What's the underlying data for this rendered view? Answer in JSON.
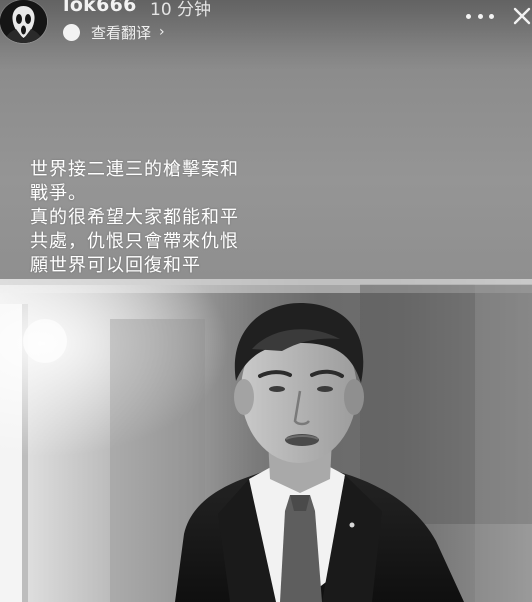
{
  "header": {
    "username": "lok666",
    "timestamp": "10 分钟",
    "translate_label": "查看翻译",
    "translate_chevron": "›"
  },
  "icons": {
    "avatar": "ghostface-mask-avatar",
    "translate": "translate-dot-icon",
    "more": "more-dots-icon",
    "close": "close-icon",
    "chevron": "chevron-right-icon"
  },
  "caption": {
    "lines": [
      "世界接二連三的槍擊案和",
      "戰爭。",
      "真的很希望大家都能和平",
      "共處，仇恨只會帶來仇恨",
      "願世界可以回復和平"
    ]
  },
  "photo": {
    "style": "black-and-white",
    "subject": "man-in-dark-suit-speaking"
  },
  "colors": {
    "overlay_background": "#8d8d8d",
    "text": "#ffffff",
    "avatar_bg": "#141414"
  }
}
